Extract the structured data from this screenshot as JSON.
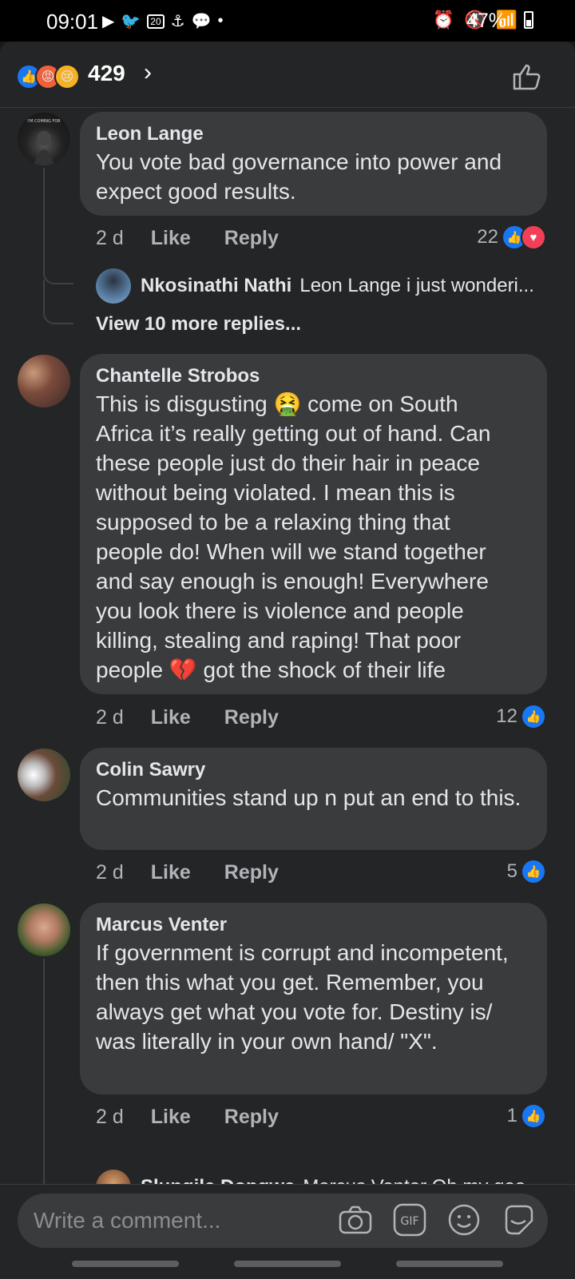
{
  "status_bar": {
    "time": "09:01",
    "notif_badge": "20",
    "battery": "47%"
  },
  "reactions": {
    "count": "429",
    "chevron": "›"
  },
  "comments": [
    {
      "name": "Leon Lange",
      "text": "You vote bad governance into power and expect good results.",
      "time": "2 d",
      "like": "Like",
      "reply": "Reply",
      "reaction_count": "22"
    },
    {
      "name": "Chantelle Strobos",
      "text_lines": [
        "This is disgusting 🤮 come on South",
        "Africa it’s really getting out of hand. Can",
        "these people just do their hair in peace",
        "without being violated. I mean this is",
        "supposed to be a relaxing thing that",
        "people do! When will we stand together",
        "and say enough is enough! Everywhere",
        "you look there is violence and people",
        "killing, stealing and raping! That poor",
        "people 💔 got the shock of their life"
      ],
      "time": "2 d",
      "like": "Like",
      "reply": "Reply",
      "reaction_count": "12"
    },
    {
      "name": "Colin Sawry",
      "text": "Communities stand up n put an end to this.",
      "time": "2 d",
      "like": "Like",
      "reply": "Reply",
      "reaction_count": "5"
    },
    {
      "name": "Marcus Venter",
      "text": "If government is corrupt and incompetent, then this what you get. Remember, you always get what you vote for. Destiny is/ was literally in your own hand/ \"X\".",
      "time": "2 d",
      "like": "Like",
      "reply": "Reply",
      "reaction_count": "1"
    }
  ],
  "replies": [
    {
      "name": "Nkosinathi Nathi",
      "preview": "Leon Lange i just wonderi..."
    },
    {
      "name": "Slungile Dongwe",
      "preview": "Marcus Venter Oh my goo..."
    }
  ],
  "view_more": "View 10 more replies...",
  "composer": {
    "placeholder": "Write a comment..."
  },
  "icon_names": [
    "thumbs-up-icon",
    "camera-icon",
    "gif-icon",
    "emoji-icon",
    "sticker-icon"
  ]
}
